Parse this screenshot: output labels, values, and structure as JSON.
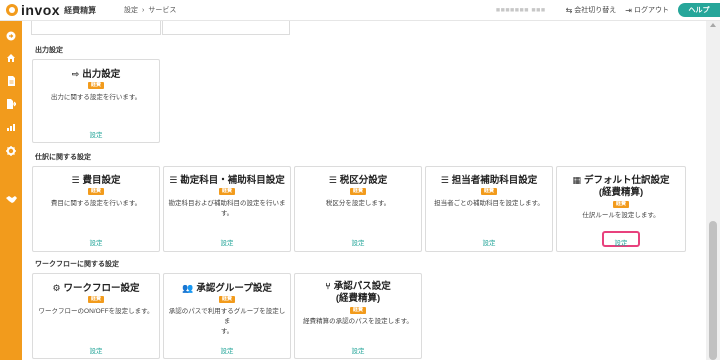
{
  "header": {
    "logo_text": "invox",
    "logo_sub": "経費精算",
    "breadcrumb": [
      "設定",
      "›",
      "サービス"
    ],
    "user_name": "■■■■■■■ ■■■",
    "switch_company": "会社切り替え",
    "logout": "ログアウト",
    "help": "ヘルプ"
  },
  "sidebar": {
    "icons": [
      "arrow-circle-icon",
      "home-icon",
      "document-icon",
      "export-icon",
      "chart-icon",
      "gear-icon",
      "handshake-icon"
    ]
  },
  "sections": [
    {
      "title": "出力設定",
      "cards": [
        {
          "title": "出力設定",
          "icon": "sign-out-icon",
          "badge": "経費",
          "desc": [
            "出力に関する設定を行います。"
          ],
          "link": "設定"
        }
      ]
    },
    {
      "title": "仕訳に関する設定",
      "cards": [
        {
          "title": "費目設定",
          "icon": "list-icon",
          "badge": "経費",
          "desc": [
            "費目に関する設定を行います。"
          ],
          "link": "設定"
        },
        {
          "title": "勘定科目・補助科目設定",
          "icon": "list-icon",
          "badge": "経費",
          "desc": [
            "勘定科目および補助科目の設定を行いま",
            "す。"
          ],
          "link": "設定"
        },
        {
          "title": "税区分設定",
          "icon": "list-icon",
          "badge": "経費",
          "desc": [
            "税区分を設定します。"
          ],
          "link": "設定"
        },
        {
          "title": "担当者補助科目設定",
          "icon": "list-icon",
          "badge": "経費",
          "desc": [
            "担当者ごとの補助科目を設定します。"
          ],
          "link": "設定"
        },
        {
          "title": "デフォルト仕訳設定",
          "title2": "(経費精算)",
          "icon": "table-icon",
          "badge": "経費",
          "desc": [
            "仕訳ルールを設定します。"
          ],
          "link": "設定"
        }
      ]
    },
    {
      "title": "ワークフローに関する設定",
      "cards": [
        {
          "title": "ワークフロー設定",
          "icon": "user-gear-icon",
          "badge": "経費",
          "desc": [
            "ワークフローのON/OFFを設定します。"
          ],
          "link": "設定"
        },
        {
          "title": "承認グループ設定",
          "icon": "users-icon",
          "badge": "経費",
          "desc": [
            "承認のパスで利用するグループを設定しま",
            "す。"
          ],
          "link": "設定"
        },
        {
          "title": "承認パス設定",
          "title2": "(経費精算)",
          "icon": "route-icon",
          "badge": "経費",
          "desc": [
            "経費精算の承認のパスを設定します。"
          ],
          "link": "設定"
        }
      ]
    }
  ],
  "colors": {
    "accent": "#f29b1c",
    "link": "#26a69a",
    "highlight": "#e8417d"
  }
}
